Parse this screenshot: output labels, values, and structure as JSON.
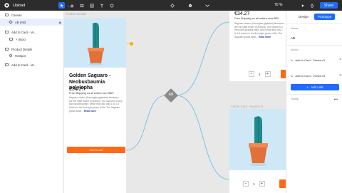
{
  "app": {
    "name": "Upload",
    "zoom": "70 %",
    "share_label": "Share"
  },
  "layers": [
    {
      "label": "Canvas",
      "icon": "frame-icon"
    },
    {
      "label": "AB (A8)",
      "icon": "component-icon",
      "selected": true
    },
    {
      "label": "Add to Card - Ve...",
      "icon": "frame-icon"
    },
    {
      "label": "+ (Box)",
      "icon": "box-icon"
    },
    {
      "label": "Product Details",
      "icon": "frame-icon"
    },
    {
      "label": "Hotspot",
      "icon": "hotspot-icon"
    },
    {
      "label": "Add to Card - Ve...",
      "icon": "frame-icon"
    }
  ],
  "canvas": {
    "frame_label_left": "Product Details",
    "frame_label_right_bottom": "Add to Card - Version B",
    "node_label": "AB",
    "product": {
      "title": "Golden Saguaro - Neobuxbaumia polylopha",
      "price": "€34.27",
      "shipping": "Free Shipping on all orders over €80*",
      "description": "Saguaro cactus (Carnegiea gigantea) blossoms are the state flower of Arizona. The cactus is a very slow growing plant, which may add only 1 to 1.5 inches in the first eight years of life. The Saguaro grows slowl...",
      "read_more": "Read more",
      "cart_button": "Add to cart",
      "qty": "1"
    }
  },
  "right_panel": {
    "tabs": [
      "Design",
      "Prototype"
    ],
    "name_label": "Name",
    "name_value": "AB",
    "action_label": "Action",
    "actions": [
      "Add to Card - Version A",
      "Add to Card - Version B"
    ],
    "add_link_label": "Add Link",
    "tooltip_label": "Tooltip"
  },
  "colors": {
    "accent": "#1f6bff",
    "cta": "#ff6a13",
    "connector": "#67b8e6"
  }
}
